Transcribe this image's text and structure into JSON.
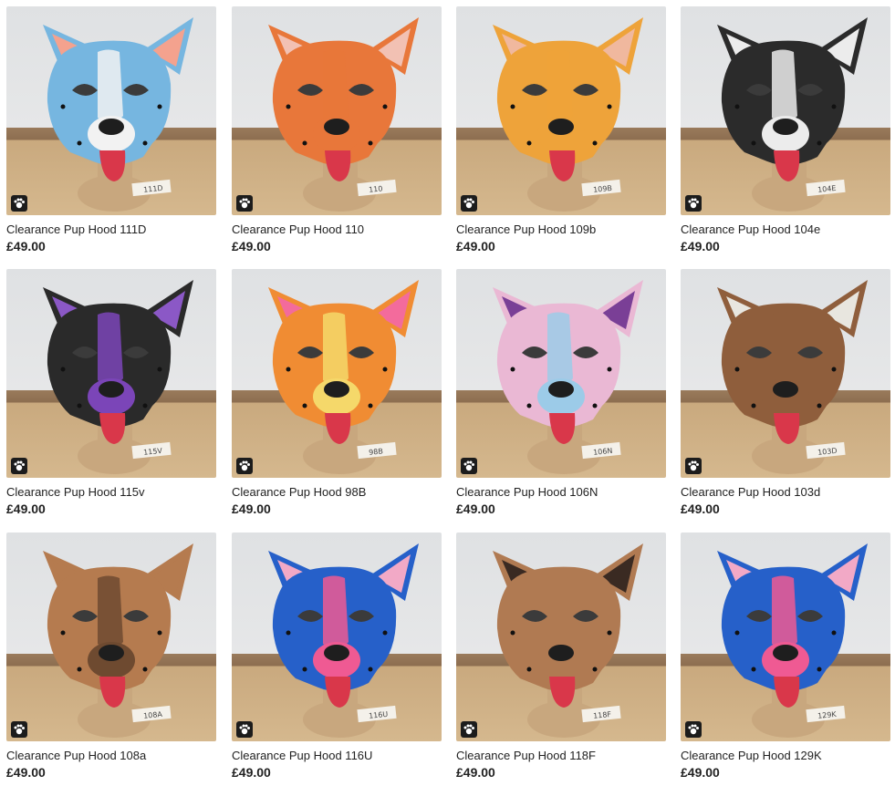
{
  "listings": [
    {
      "title": "Clearance Pup Hood 111D",
      "price": "£49.00",
      "mask_color": "#76b6e0",
      "accent_color": "#f2f2f2",
      "ear_color": "#f4a28e",
      "tag": "111D"
    },
    {
      "title": "Clearance Pup Hood 110",
      "price": "£49.00",
      "mask_color": "#e8773a",
      "accent_color": "#e8773a",
      "ear_color": "#f2c1b3",
      "tag": "110"
    },
    {
      "title": "Clearance Pup Hood 109b",
      "price": "£49.00",
      "mask_color": "#eea33a",
      "accent_color": "#eea33a",
      "ear_color": "#f0b89e",
      "tag": "109B"
    },
    {
      "title": "Clearance Pup Hood 104e",
      "price": "£49.00",
      "mask_color": "#2b2b2b",
      "accent_color": "#ececec",
      "ear_color": "#ececec",
      "tag": "104E"
    },
    {
      "title": "Clearance Pup Hood 115v",
      "price": "£49.00",
      "mask_color": "#2a2a2a",
      "accent_color": "#7b45b8",
      "ear_color": "#8b58c6",
      "tag": "115V"
    },
    {
      "title": "Clearance Pup Hood 98B",
      "price": "£49.00",
      "mask_color": "#f08c33",
      "accent_color": "#f5d86a",
      "ear_color": "#f36b9c",
      "tag": "98B"
    },
    {
      "title": "Clearance Pup Hood 106N",
      "price": "£49.00",
      "mask_color": "#eab8d4",
      "accent_color": "#9ccbe8",
      "ear_color": "#7a3f96",
      "tag": "106N"
    },
    {
      "title": "Clearance Pup Hood 103d",
      "price": "£49.00",
      "mask_color": "#8f5e3c",
      "accent_color": "#8f5e3c",
      "ear_color": "#e8e6df",
      "tag": "103D"
    },
    {
      "title": "Clearance Pup Hood 108a",
      "price": "£49.00",
      "mask_color": "#b57b4f",
      "accent_color": "#6e4a30",
      "ear_color": "#b57b4f",
      "tag": "108A"
    },
    {
      "title": "Clearance Pup Hood 116U",
      "price": "£49.00",
      "mask_color": "#2660c9",
      "accent_color": "#ef5a93",
      "ear_color": "#f2a9c6",
      "tag": "116U"
    },
    {
      "title": "Clearance Pup Hood 118F",
      "price": "£49.00",
      "mask_color": "#b07a52",
      "accent_color": "#b07a52",
      "ear_color": "#3a2a22",
      "tag": "118F"
    },
    {
      "title": "Clearance Pup Hood 129K",
      "price": "£49.00",
      "mask_color": "#2660c9",
      "accent_color": "#ef5a93",
      "ear_color": "#f2a9c6",
      "tag": "129K"
    }
  ],
  "icons": {
    "badge": "paw-logo-icon"
  },
  "colors": {
    "text": "#222222",
    "tongue": "#d9374a",
    "stand": "#c8a77e"
  }
}
